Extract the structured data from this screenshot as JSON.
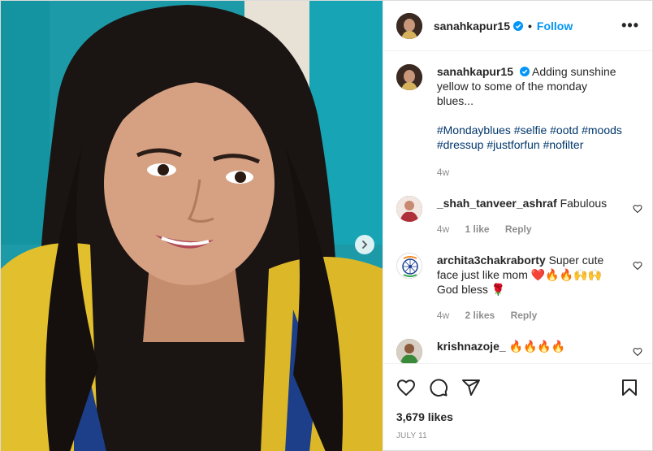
{
  "account": {
    "username": "sanahkapur15",
    "follow_label": "Follow",
    "separator": "•",
    "more_label": "•••"
  },
  "caption": {
    "username": "sanahkapur15",
    "text": "Adding sunshine yellow to some of the monday blues...",
    "hashtags": [
      "#Mondayblues",
      "#selfie",
      "#ootd",
      "#moods",
      "#dressup",
      "#justforfun",
      "#nofilter"
    ],
    "time": "4w"
  },
  "comments": [
    {
      "username": "_shah_tanveer_ashraf",
      "text": "Fabulous",
      "time": "4w",
      "likes": "1 like",
      "reply": "Reply"
    },
    {
      "username": "archita3chakraborty",
      "text": "Super cute face just like mom ❤️🔥🔥🙌🙌 God bless 🌹",
      "time": "4w",
      "likes": "2 likes",
      "reply": "Reply"
    },
    {
      "username": "krishnazoje_",
      "text": "🔥🔥🔥🔥",
      "time": "",
      "likes": "",
      "reply": ""
    }
  ],
  "stats": {
    "likes": "3,679 likes",
    "date": "JULY 11"
  },
  "colors": {
    "accent": "#0095f6",
    "hashtag": "#00376b",
    "muted": "#8e8e8e",
    "photo_background": "#1aa0ad",
    "sweater": "#e3c02c"
  }
}
